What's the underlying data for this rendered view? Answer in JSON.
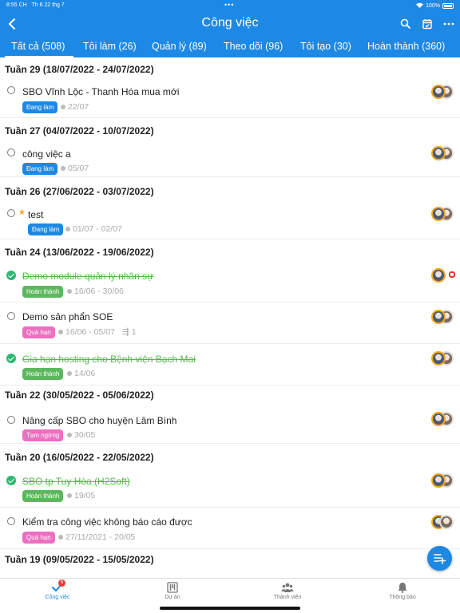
{
  "status_bar": {
    "time": "8:55 CH",
    "date": "Th 6 22 thg 7",
    "battery": "100%"
  },
  "header": {
    "title": "Công việc"
  },
  "tabs": [
    {
      "label": "Tất cả (508)"
    },
    {
      "label": "Tôi làm (26)"
    },
    {
      "label": "Quản lý (89)"
    },
    {
      "label": "Theo dõi (96)"
    },
    {
      "label": "Tôi tạo (30)"
    },
    {
      "label": "Hoàn thành (360)"
    }
  ],
  "colors": {
    "primary": "#1e88e5",
    "in_progress": "#1e88e5",
    "done": "#5cb85c",
    "overdue": "#ec6fc0",
    "paused": "#ec6fc0"
  },
  "weeks": [
    {
      "label": "Tuần  29 (18/07/2022 - 24/07/2022)"
    },
    {
      "label": "Tuần  27 (04/07/2022 - 10/07/2022)"
    },
    {
      "label": "Tuần  26 (27/06/2022 - 03/07/2022)"
    },
    {
      "label": "Tuần  24 (13/06/2022 - 19/06/2022)"
    },
    {
      "label": "Tuần  22 (30/05/2022 - 05/06/2022)"
    },
    {
      "label": "Tuần  20 (16/05/2022 - 22/05/2022)"
    },
    {
      "label": "Tuần  19 (09/05/2022 - 15/05/2022)"
    }
  ],
  "tasks": [
    {
      "name": "SBO Vĩnh Lộc - Thanh Hóa mua mới",
      "status": "Đang làm",
      "date": "22/07",
      "done": false
    },
    {
      "name": "công việc a",
      "status": "Đang làm",
      "date": "05/07",
      "done": false
    },
    {
      "name": "test",
      "status": "Đang làm",
      "date": "01/07 - 02/07",
      "done": false,
      "starred": true
    },
    {
      "name": "Demo module quản lý nhân sự",
      "status": "Hoàn thành",
      "date": "16/06 - 30/06",
      "done": true
    },
    {
      "name": "Demo sản phẩn SOE",
      "status": "Quá hạn",
      "date": "16/06 - 05/07",
      "subtasks": "1",
      "done": false
    },
    {
      "name": "Gia hạn hosting cho Bệnh viện Bạch Mai",
      "status": "Hoàn thành",
      "date": "14/06",
      "done": true
    },
    {
      "name": "Nâng cấp SBO cho huyện Lâm Bình",
      "status": "Tạm ngừng",
      "date": "30/05",
      "done": false
    },
    {
      "name": "SBO tp Tuy Hòa (H2Soft)",
      "status": "Hoàn thành",
      "date": "19/05",
      "done": true
    },
    {
      "name": "Kiểm tra công việc không báo cáo được",
      "status": "Quá hạn",
      "date": "27/11/2021 - 20/05",
      "done": false
    }
  ],
  "bottom_nav": [
    {
      "label": "Công việc",
      "icon": "task-check-icon",
      "badge": "6"
    },
    {
      "label": "Dự án",
      "icon": "project-board-icon"
    },
    {
      "label": "Thành viên",
      "icon": "members-icon"
    },
    {
      "label": "Thông báo",
      "icon": "bell-icon"
    }
  ]
}
